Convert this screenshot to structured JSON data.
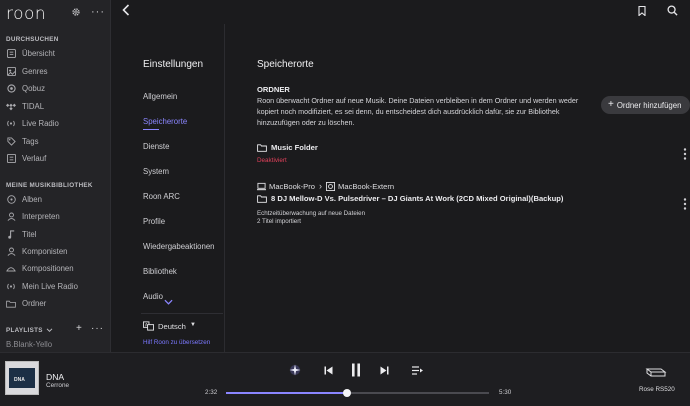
{
  "app": {
    "brand": "roon"
  },
  "sidebar": {
    "browse_heading": "DURCHSUCHEN",
    "browse_items": [
      {
        "label": "Übersicht",
        "icon": "overview-icon",
        "active": true
      },
      {
        "label": "Genres",
        "icon": "genres-icon"
      },
      {
        "label": "Qobuz",
        "icon": "qobuz-icon"
      },
      {
        "label": "TIDAL",
        "icon": "tidal-icon"
      },
      {
        "label": "Live Radio",
        "icon": "radio-icon"
      },
      {
        "label": "Tags",
        "icon": "tag-icon"
      },
      {
        "label": "Verlauf",
        "icon": "history-icon"
      }
    ],
    "library_heading": "MEINE MUSIKBIBLIOTHEK",
    "library_items": [
      {
        "label": "Alben",
        "icon": "album-icon"
      },
      {
        "label": "Interpreten",
        "icon": "artist-icon"
      },
      {
        "label": "Titel",
        "icon": "track-icon"
      },
      {
        "label": "Komponisten",
        "icon": "composer-icon"
      },
      {
        "label": "Kompositionen",
        "icon": "composition-icon"
      },
      {
        "label": "Mein Live Radio",
        "icon": "my-radio-icon"
      },
      {
        "label": "Ordner",
        "icon": "folder-icon"
      }
    ],
    "playlists_heading": "PLAYLISTS",
    "playlist_first": "B.Blank-Yello"
  },
  "settings_nav": {
    "title": "Einstellungen",
    "items": [
      {
        "label": "Allgemein"
      },
      {
        "label": "Speicherorte",
        "active": true
      },
      {
        "label": "Dienste"
      },
      {
        "label": "System"
      },
      {
        "label": "Roon ARC"
      },
      {
        "label": "Profile"
      },
      {
        "label": "Wiedergabeaktionen"
      },
      {
        "label": "Bibliothek"
      },
      {
        "label": "Audio"
      }
    ],
    "language": "Deutsch",
    "help_link": "Hilf Roon zu übersetzen"
  },
  "main": {
    "title": "Speicherorte",
    "ordner_heading": "ORDNER",
    "ordner_description": "Roon überwacht Ordner auf neue Musik. Deine Dateien verbleiben in dem Ordner und werden weder kopiert noch modifiziert, es sei denn, du entscheidest dich ausdrücklich dafür, sie zur Bibliothek hinzuzufügen oder zu löschen.",
    "add_button": "Ordner hinzufügen",
    "folder1": {
      "name": "Music Folder",
      "status": "Deaktiviert"
    },
    "folder2": {
      "path_device": "MacBook-Pro",
      "path_drive": "MacBook-Extern",
      "name": "8 DJ Mellow-D Vs. Pulsedriver – DJ Giants At Work (2CD Mixed Original)(Backup)",
      "note1": "Echtzeitüberwachung auf neue Dateien",
      "note2": "2 Titel importiert"
    }
  },
  "player": {
    "album_art_text": "DNA",
    "track_title": "DNA",
    "track_artist": "Cerrone",
    "time_elapsed": "2:32",
    "time_total": "5:30",
    "progress_fraction": 0.4606,
    "zone": "Rose RS520"
  },
  "colors": {
    "accent": "#8b86ff",
    "danger": "#e0405a"
  }
}
